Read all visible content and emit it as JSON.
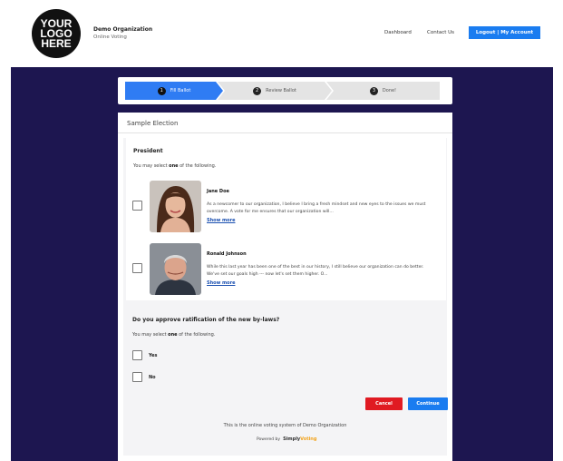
{
  "header": {
    "logo_text": "YOUR\nLOGO\nHERE",
    "org_name": "Demo Organization",
    "org_subtitle": "Online Voting",
    "nav": {
      "dashboard": "Dashboard",
      "contact": "Contact Us",
      "account": "Logout | My Account"
    }
  },
  "stepper": {
    "steps": [
      {
        "number": "1",
        "label": "Fill Ballot",
        "active": true
      },
      {
        "number": "2",
        "label": "Review Ballot",
        "active": false
      },
      {
        "number": "3",
        "label": "Done!",
        "active": false
      }
    ]
  },
  "election": {
    "title": "Sample Election",
    "races": [
      {
        "title": "President",
        "instruction_prefix": "You may select ",
        "instruction_bold": "one",
        "instruction_suffix": " of the following.",
        "candidates": [
          {
            "name": "Jane Doe",
            "bio": "As a newcomer to our organization, I believe I bring a fresh mindset and new eyes to the issues we must overcome. A vote for me ensures that our organization will...",
            "show_more": "Show more",
            "checked": false
          },
          {
            "name": "Ronald Johnson",
            "bio": "While this last year has been one of the best in our history, I still believe our organization can do better. We've set our goals high --- now let's set them higher. O...",
            "show_more": "Show more",
            "checked": false
          }
        ]
      }
    ],
    "question": {
      "title": "Do you approve ratification of the new by-laws?",
      "instruction_prefix": "You may select ",
      "instruction_bold": "one",
      "instruction_suffix": " of the following.",
      "options": [
        {
          "label": "Yes",
          "checked": false
        },
        {
          "label": "No",
          "checked": false
        }
      ]
    }
  },
  "actions": {
    "cancel": "Cancel",
    "continue": "Continue"
  },
  "footer": {
    "note": "This is the online voting system of Demo Organization",
    "powered_by": "Powered by",
    "brand_main": "Simply",
    "brand_accent": "Voting"
  },
  "colors": {
    "primary": "#1a7cf0",
    "danger": "#e01a22",
    "background": "#1d1650"
  }
}
